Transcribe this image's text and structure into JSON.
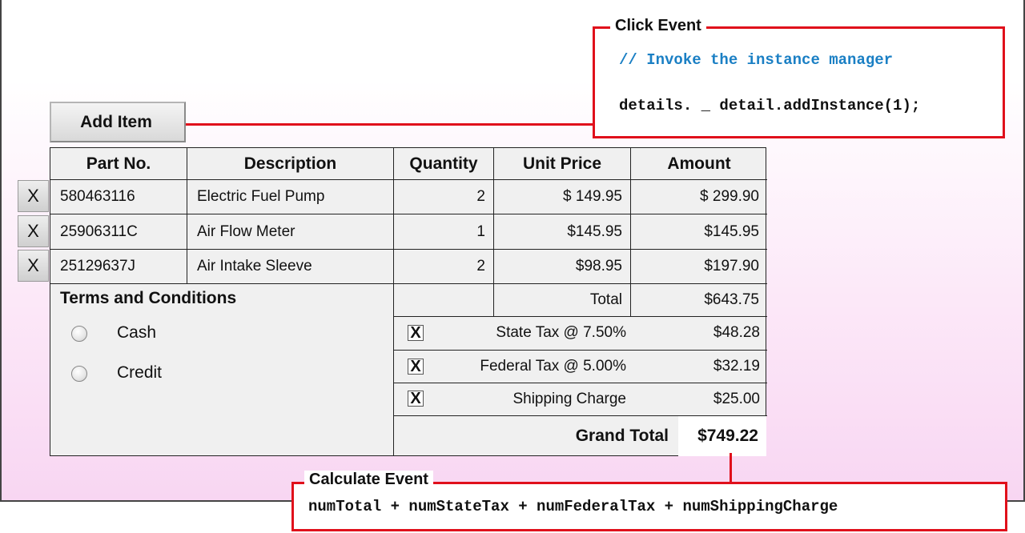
{
  "add_button": {
    "label": "Add Item"
  },
  "table": {
    "headers": [
      "Part No.",
      "Description",
      "Quantity",
      "Unit Price",
      "Amount"
    ],
    "rows": [
      {
        "part_no": "580463116",
        "description": "Electric Fuel Pump",
        "quantity": "2",
        "unit_price": "$ 149.95",
        "amount": "$ 299.90"
      },
      {
        "part_no": "25906311C",
        "description": "Air Flow Meter",
        "quantity": "1",
        "unit_price": "$145.95",
        "amount": "$145.95"
      },
      {
        "part_no": "25129637J",
        "description": "Air Intake Sleeve",
        "quantity": "2",
        "unit_price": "$98.95",
        "amount": "$197.90"
      }
    ],
    "delete_label": "X"
  },
  "terms": {
    "title": "Terms and Conditions",
    "options": [
      {
        "label": "Cash",
        "selected": false
      },
      {
        "label": "Credit",
        "selected": false
      }
    ]
  },
  "totals": {
    "total_label": "Total",
    "total_value": "$643.75",
    "state_tax": {
      "label": "State Tax @ 7.50%",
      "value": "$48.28",
      "checked": true
    },
    "federal_tax": {
      "label": "Federal Tax @ 5.00%",
      "value": "$32.19",
      "checked": true
    },
    "shipping": {
      "label": "Shipping Charge",
      "value": "$25.00",
      "checked": true
    },
    "check_mark": "X",
    "grand_total_label": "Grand Total",
    "grand_total_value": "$749.22"
  },
  "click_event": {
    "title": "Click Event",
    "comment": "// Invoke the instance manager",
    "code": "details. _ detail.addInstance(1);"
  },
  "calculate_event": {
    "title": "Calculate Event",
    "code": "numTotal + numStateTax + numFederalTax + numShippingCharge"
  },
  "colors": {
    "callout_border": "#e0101b",
    "comment_text": "#1a7fc4",
    "gradient_bottom": "#f8d6f2"
  }
}
